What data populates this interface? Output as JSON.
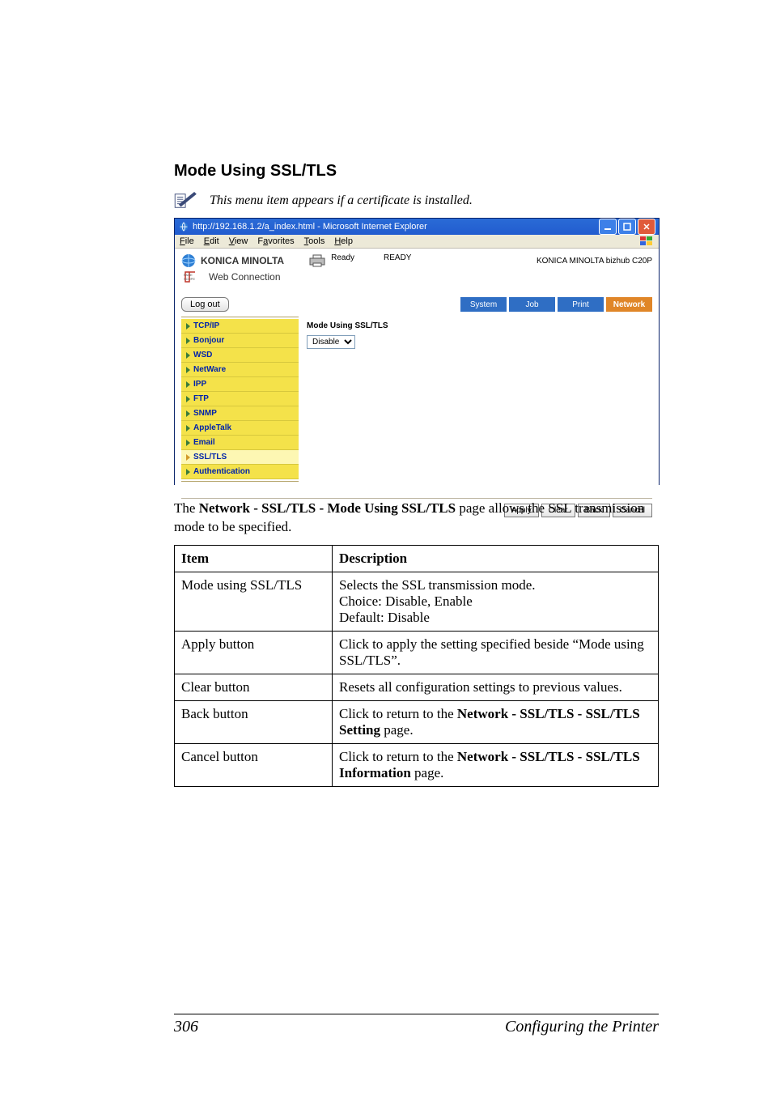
{
  "heading": "Mode Using SSL/TLS",
  "note": "This menu item appears if a certificate is installed.",
  "screenshot": {
    "window_title": "http://192.168.1.2/a_index.html - Microsoft Internet Explorer",
    "menus": {
      "file": "File",
      "edit": "Edit",
      "view": "View",
      "favorites": "Favorites",
      "tools": "Tools",
      "help": "Help"
    },
    "brand": "KONICA MINOLTA",
    "brand_sub": "Web Connection",
    "status_label": "Ready",
    "status_value": "READY",
    "model": "KONICA MINOLTA bizhub C20P",
    "logout": "Log out",
    "tabs": {
      "system": "System",
      "job": "Job",
      "print": "Print",
      "network": "Network"
    },
    "side": {
      "tcpip": "TCP/IP",
      "bonjour": "Bonjour",
      "wsd": "WSD",
      "netware": "NetWare",
      "ipp": "IPP",
      "ftp": "FTP",
      "snmp": "SNMP",
      "appletalk": "AppleTalk",
      "email": "Email",
      "ssltls": "SSL/TLS",
      "auth": "Authentication"
    },
    "main_title": "Mode Using SSL/TLS",
    "select_value": "Disable",
    "buttons": {
      "apply": "Apply",
      "clear": "Clear",
      "back": "Back",
      "cancel": "Cancel"
    }
  },
  "paragraph": {
    "pre": "The ",
    "bold": "Network - SSL/TLS - Mode Using SSL/TLS",
    "post": " page allows the SSL transmission mode to be specified."
  },
  "table": {
    "h_item": "Item",
    "h_desc": "Description",
    "rows": [
      {
        "item": "Mode using SSL/TLS",
        "desc": "Selects the SSL transmission mode.\nChoice:  Disable, Enable\nDefault:  Disable"
      },
      {
        "item": "Apply button",
        "desc": "Click to apply the setting specified beside “Mode using SSL/TLS”."
      },
      {
        "item": "Clear button",
        "desc": "Resets all configuration settings to previous values."
      },
      {
        "item": "Back button",
        "desc_pre": "Click to return to the ",
        "desc_bold": "Network - SSL/TLS - SSL/TLS Setting",
        "desc_post": " page."
      },
      {
        "item": "Cancel button",
        "desc_pre": "Click to return to the ",
        "desc_bold": "Network - SSL/TLS - SSL/TLS Information",
        "desc_post": " page."
      }
    ]
  },
  "footer": {
    "page": "306",
    "title": "Configuring the Printer"
  }
}
